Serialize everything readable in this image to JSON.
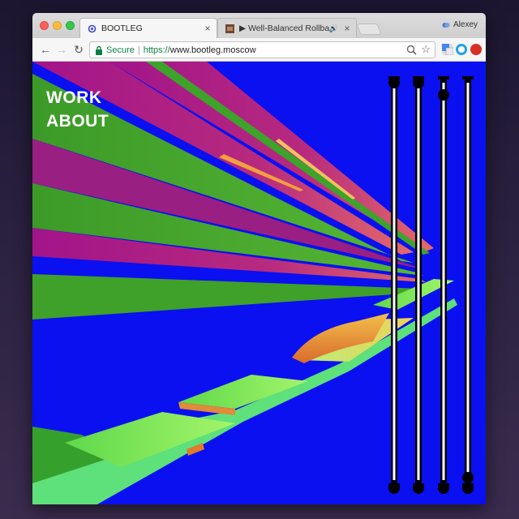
{
  "browser": {
    "tabs": [
      {
        "title": "BOOTLEG",
        "active": true,
        "icon": "bootleg-favicon"
      },
      {
        "title": "▶ Well-Balanced Rollback |",
        "active": false,
        "icon": "video-thumbnail",
        "audio": "speaker-icon"
      }
    ],
    "profile_name": "Alexey",
    "secure_label": "Secure",
    "url_scheme": "https://",
    "url_host": "www.bootleg.moscow",
    "colors": {
      "secure_green": "#0b8043",
      "page_background": "#0a10f0"
    }
  },
  "page": {
    "menu": [
      {
        "label": "WORK"
      },
      {
        "label": "ABOUT"
      }
    ],
    "sliders": [
      {
        "name": "slider-1",
        "value_fraction": 1.0
      },
      {
        "name": "slider-2",
        "value_fraction": 1.0
      },
      {
        "name": "slider-3",
        "value_fraction": 0.97
      },
      {
        "name": "slider-4",
        "value_fraction": 0.03
      }
    ],
    "colors": {
      "blue": "#0a10f0",
      "green": "#3fa02a",
      "magenta": "#9a1f82",
      "lime": "#8ef25c",
      "orange": "#e8a23a",
      "white": "#ffffff",
      "black": "#000000"
    }
  }
}
